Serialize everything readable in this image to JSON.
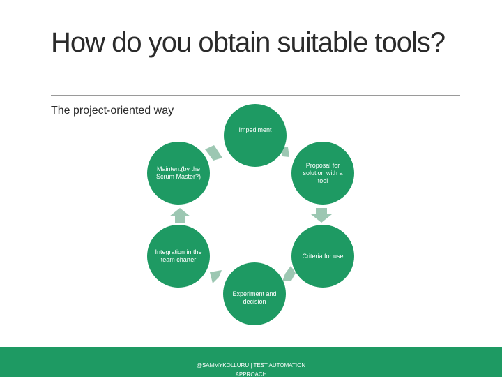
{
  "slide": {
    "title": "How do you obtain suitable tools?",
    "subtitle": "The project-oriented way"
  },
  "cycle": {
    "nodes": [
      {
        "label": "Impediment"
      },
      {
        "label": "Proposal for solution with a tool"
      },
      {
        "label": "Criteria for use"
      },
      {
        "label": "Experiment and decision"
      },
      {
        "label": "Integration in the team charter"
      },
      {
        "label": "Mainten.(by the Scrum Master?)"
      }
    ]
  },
  "footer": {
    "text": "@SAMMYKOLLURU | TEST AUTOMATION APPROACH"
  },
  "colors": {
    "node": "#1e9a63",
    "arrow": "#9cc7b2",
    "footer": "#1e9a63"
  }
}
